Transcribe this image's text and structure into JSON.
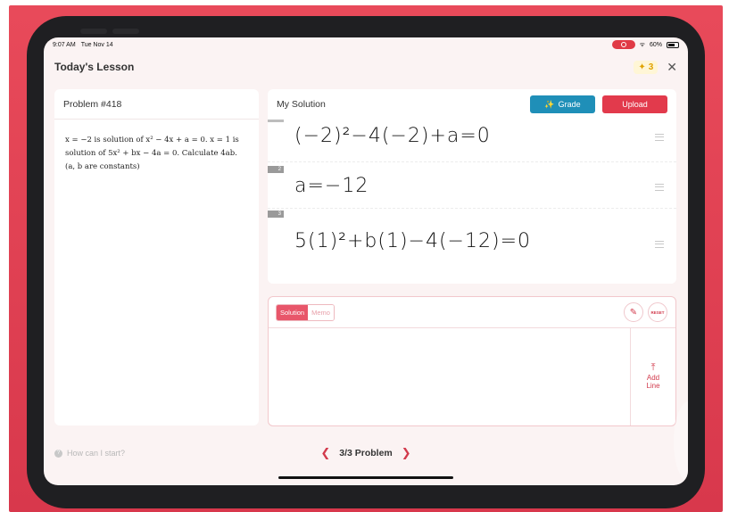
{
  "status": {
    "time": "9:07 AM",
    "date": "Tue Nov 14",
    "battery": "60%"
  },
  "header": {
    "title": "Today's Lesson",
    "stars": "3"
  },
  "problem": {
    "title": "Problem #418",
    "text": "x = −2 is solution of x² − 4x + a = 0. x = 1 is solution of 5x² + bx − 4a = 0. Calculate 4ab. (a, b are constants)"
  },
  "solution": {
    "title": "My Solution",
    "grade_label": "Grade",
    "upload_label": "Upload",
    "lines": [
      {
        "num": "",
        "text": "(−2)²−4(−2)+a=0"
      },
      {
        "num": "2",
        "text": "a=−12"
      },
      {
        "num": "3",
        "text": "5(1)²+b(1)−4(−12)=0"
      }
    ]
  },
  "input": {
    "tab_solution": "Solution",
    "tab_memo": "Memo",
    "reset_label": "RESET",
    "add_line_label": "Add Line"
  },
  "footer": {
    "hint": "How can I start?",
    "pager": "3/3 Problem"
  },
  "colors": {
    "accent": "#e23a4c",
    "grade": "#1f8fb8",
    "background": "#d8384c"
  }
}
